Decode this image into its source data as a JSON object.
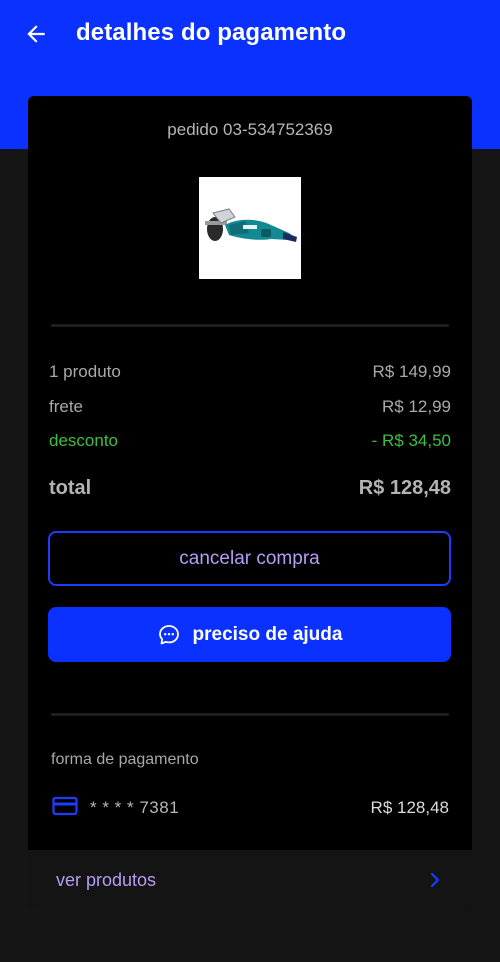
{
  "colors": {
    "brand_blue": "#0a31ff",
    "discount_green": "#3fbf3f",
    "link_purple": "#b79cf5",
    "background": "#151515",
    "card": "#000000"
  },
  "appbar": {
    "title": "detalhes do pagamento",
    "back_icon": "arrow-left-icon"
  },
  "order": {
    "label": "pedido 03-534752369",
    "thumbnail_icon": "angle-grinder-product-image"
  },
  "summary": {
    "products_label": "1 produto",
    "products_value": "R$ 149,99",
    "shipping_label": "frete",
    "shipping_value": "R$ 12,99",
    "discount_label": "desconto",
    "discount_value": "- R$ 34,50",
    "total_label": "total",
    "total_value": "R$ 128,48"
  },
  "actions": {
    "cancel_label": "cancelar compra",
    "help_label": "preciso de ajuda",
    "help_icon": "chat-bubble-icon"
  },
  "payment": {
    "title": "forma de pagamento",
    "card_icon": "credit-card-icon",
    "card_masked": "* * * * 7381",
    "amount": "R$ 128,48"
  },
  "footer": {
    "label": "ver produtos",
    "chevron_icon": "chevron-right-icon"
  }
}
